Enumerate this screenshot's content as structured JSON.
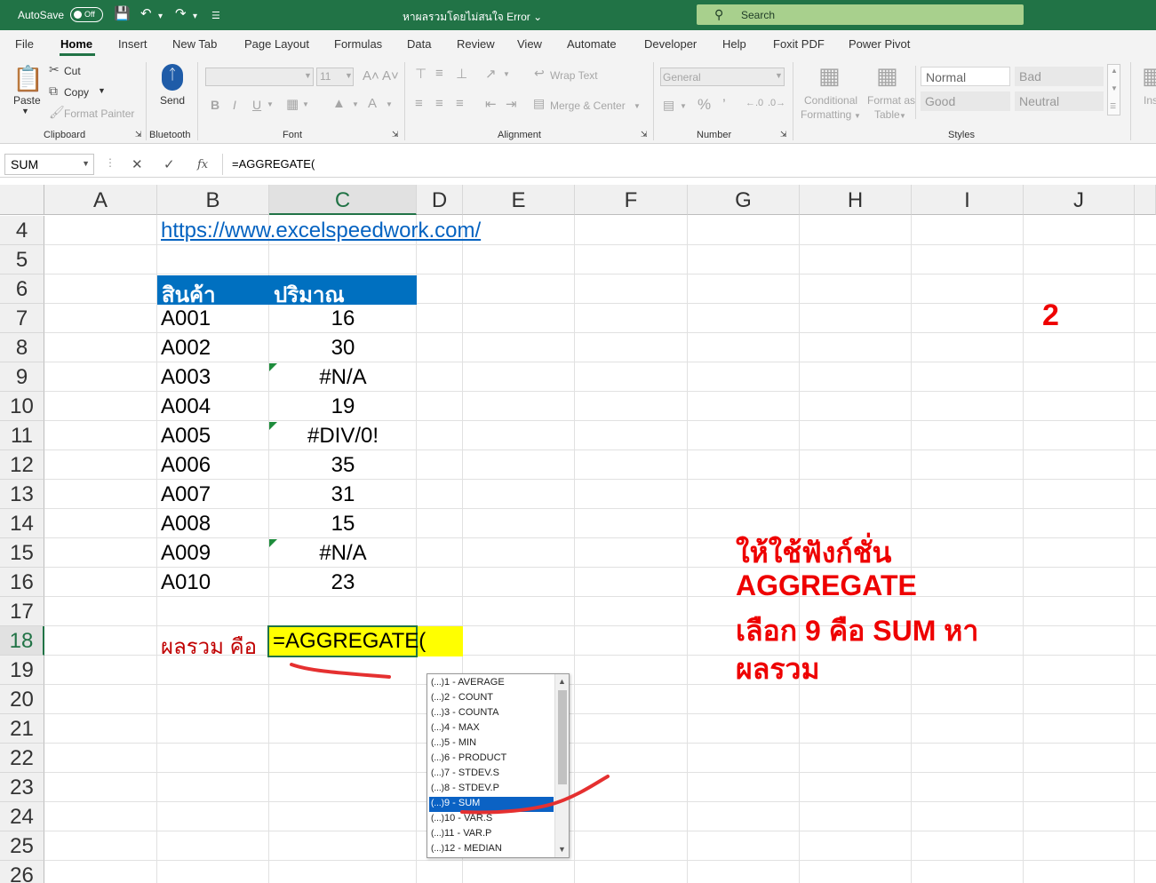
{
  "titlebar": {
    "autosave_label": "AutoSave",
    "autosave_state": "Off",
    "document_title": "หาผลรวมโดยไม่สนใจ Error",
    "search_label": "Search"
  },
  "menu": {
    "tabs": [
      "File",
      "Home",
      "Insert",
      "New Tab",
      "Page Layout",
      "Formulas",
      "Data",
      "Review",
      "View",
      "Automate",
      "Developer",
      "Help",
      "Foxit PDF",
      "Power Pivot"
    ],
    "active_tab": "Home"
  },
  "ribbon": {
    "clipboard": {
      "paste": "Paste",
      "cut": "Cut",
      "copy": "Copy",
      "format_painter": "Format Painter",
      "group": "Clipboard"
    },
    "bluetooth": {
      "send": "Send",
      "group": "Bluetooth"
    },
    "font": {
      "size": "11",
      "group": "Font"
    },
    "alignment": {
      "wrap_text": "Wrap Text",
      "merge_center": "Merge & Center",
      "group": "Alignment"
    },
    "number": {
      "format": "General",
      "group": "Number"
    },
    "styles": {
      "conditional_formatting": [
        "Conditional",
        "Formatting"
      ],
      "format_as_table": [
        "Format as",
        "Table"
      ],
      "normal": "Normal",
      "bad": "Bad",
      "good": "Good",
      "neutral": "Neutral",
      "group": "Styles"
    },
    "insert_partial": "Ins"
  },
  "formula_bar": {
    "name_box": "SUM",
    "fx_label": "fx",
    "formula": "=AGGREGATE("
  },
  "sheet": {
    "columns": [
      "A",
      "B",
      "C",
      "D",
      "E",
      "F",
      "G",
      "H",
      "I",
      "J"
    ],
    "rows": [
      "4",
      "5",
      "6",
      "7",
      "8",
      "9",
      "10",
      "11",
      "12",
      "13",
      "14",
      "15",
      "16",
      "17",
      "18",
      "19",
      "20",
      "21",
      "22",
      "23",
      "24",
      "25",
      "26"
    ],
    "link": "https://www.excelspeedwork.com/",
    "header_product": "สินค้า",
    "header_qty": "ปริมาณ",
    "data_rows": [
      {
        "product": "A001",
        "qty": "16"
      },
      {
        "product": "A002",
        "qty": "30"
      },
      {
        "product": "A003",
        "qty": "#N/A"
      },
      {
        "product": "A004",
        "qty": "19"
      },
      {
        "product": "A005",
        "qty": "#DIV/0!"
      },
      {
        "product": "A006",
        "qty": "35"
      },
      {
        "product": "A007",
        "qty": "31"
      },
      {
        "product": "A008",
        "qty": "15"
      },
      {
        "product": "A009",
        "qty": "#N/A"
      },
      {
        "product": "A010",
        "qty": "23"
      }
    ],
    "total_label": "ผลรวม คือ",
    "total_formula": "=AGGREGATE("
  },
  "autocomplete": {
    "items": [
      "1 - AVERAGE",
      "2 - COUNT",
      "3 - COUNTA",
      "4 - MAX",
      "5 - MIN",
      "6 - PRODUCT",
      "7 - STDEV.S",
      "8 - STDEV.P",
      "9 - SUM",
      "10 - VAR.S",
      "11 - VAR.P",
      "12 - MEDIAN"
    ],
    "selected_index": 8,
    "item_glyph": "(...)"
  },
  "annotations": {
    "step_number": "2",
    "line1": "ให้ใช้ฟังก์ชั่น",
    "line2": "AGGREGATE",
    "line3": "เลือก 9  คือ SUM หา",
    "line4": "ผลรวม"
  },
  "colors": {
    "excel_green": "#217346",
    "header_blue": "#0070c0",
    "highlight_yellow": "#ffff00",
    "annotation_red": "#ee0000",
    "total_label_red": "#c00000",
    "link_blue": "#0563c1"
  }
}
